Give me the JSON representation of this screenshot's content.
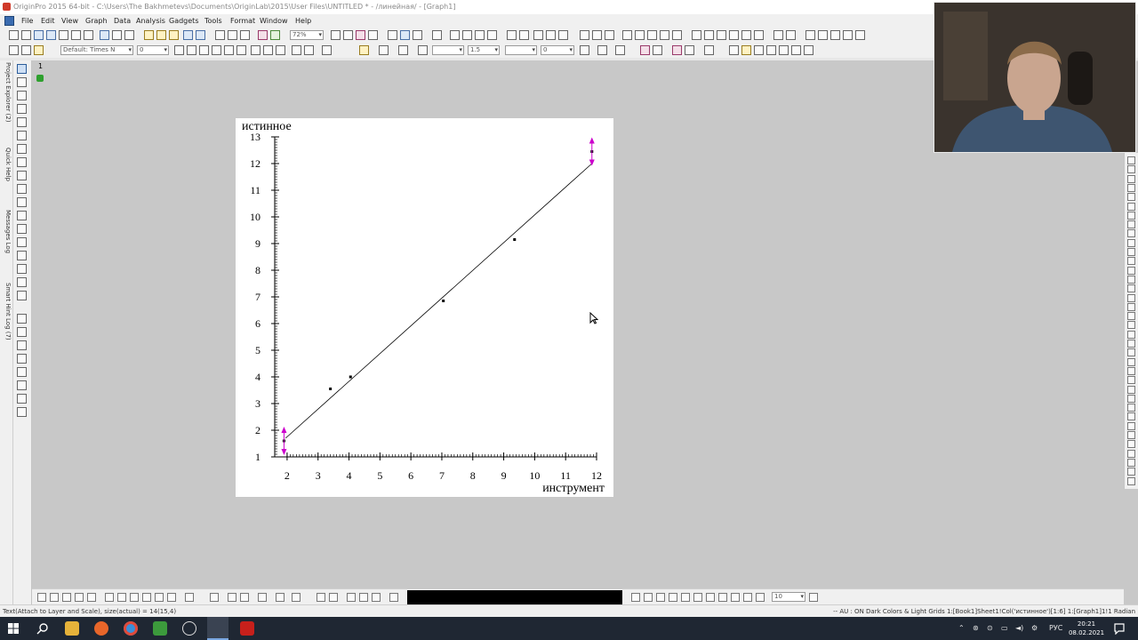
{
  "window": {
    "title": "OriginPro 2015 64-bit - C:\\Users\\The Bakhmetevs\\Documents\\OriginLab\\2015\\User Files\\UNTITLED * - /линейная/ - [Graph1]"
  },
  "menu": [
    "File",
    "Edit",
    "View",
    "Graph",
    "Data",
    "Analysis",
    "Gadgets",
    "Tools",
    "Format",
    "Window",
    "Help"
  ],
  "toolbar": {
    "zoom": "72%",
    "font": "Default: Times N",
    "font_size": "0",
    "line_width": "1.5",
    "width2": "0"
  },
  "side_tabs": [
    "Project Explorer (2)",
    "Quick Help",
    "Messages Log",
    "Smart Hint Log (7)"
  ],
  "layer_number": "1",
  "chart_data": {
    "type": "scatter",
    "xlabel": "инструмент",
    "ylabel": "истинное",
    "x_ticks": [
      "2",
      "3",
      "4",
      "5",
      "6",
      "7",
      "8",
      "9",
      "10",
      "11",
      "12"
    ],
    "y_ticks": [
      "1",
      "2",
      "3",
      "4",
      "5",
      "6",
      "7",
      "8",
      "9",
      "10",
      "11",
      "12",
      "13"
    ],
    "xlim": [
      1.6,
      12.0
    ],
    "ylim": [
      1,
      13
    ],
    "points": [
      {
        "x": 1.9,
        "y": 1.6
      },
      {
        "x": 3.4,
        "y": 3.55
      },
      {
        "x": 4.05,
        "y": 4.0
      },
      {
        "x": 7.05,
        "y": 6.85
      },
      {
        "x": 9.35,
        "y": 9.15
      },
      {
        "x": 11.85,
        "y": 12.45
      }
    ],
    "fit_line": {
      "x": [
        1.95,
        11.85
      ],
      "y": [
        1.7,
        12.0
      ]
    },
    "error_bar_points": [
      0,
      5
    ],
    "colors": {
      "points": "#000000",
      "line": "#000000",
      "handles": "#cc00cc"
    }
  },
  "bottom_toolbar": {
    "field_value": "10"
  },
  "status": {
    "left": "Text(Attach to Layer and Scale), size(actual) = 14(15,4)",
    "right": "-- AU : ON  Dark Colors & Light Grids  1:[Book1]Sheet1!Col('истинное')[1:6]  1:[Graph1]1!1  Radian"
  },
  "taskbar": {
    "lang": "РУС",
    "time": "20:21",
    "date": "08.02.2021"
  }
}
